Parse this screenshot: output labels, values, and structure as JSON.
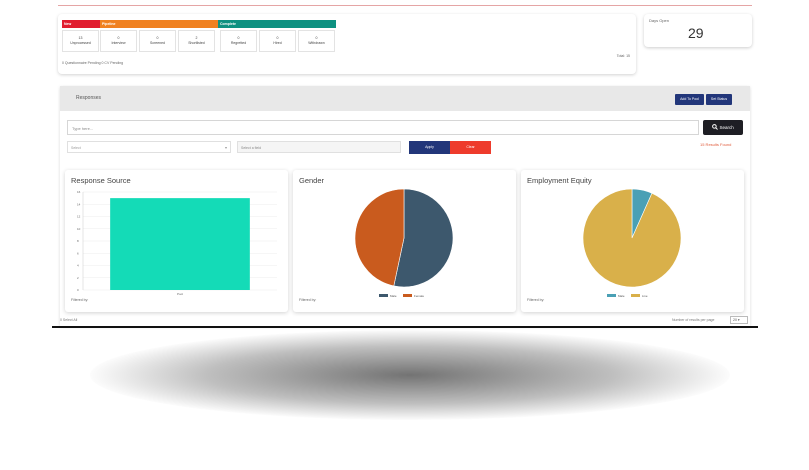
{
  "pipeline": {
    "stages": [
      {
        "label": "New",
        "color": "#e11d2f"
      },
      {
        "label": "Pipeline",
        "color": "#f08121"
      },
      {
        "label": "Complete",
        "color": "#0e9181"
      }
    ],
    "stats": [
      {
        "value": "13",
        "label": "Unprocessed"
      },
      {
        "value": "0",
        "label": "Interview"
      },
      {
        "value": "0",
        "label": "Screened"
      },
      {
        "value": "2",
        "label": "Shortlisted"
      },
      {
        "value": "0",
        "label": "Regretted"
      },
      {
        "value": "0",
        "label": "Hired"
      },
      {
        "value": "0",
        "label": "Withdrawn"
      }
    ],
    "footnote": "0 Questionnaire Pending  0 CV Pending",
    "total": "Total: 15"
  },
  "days_open": {
    "label": "Days Open",
    "value": "29"
  },
  "responses": {
    "title": "Responses",
    "add_to_pool": "Add To Pool",
    "set_status": "Set Status",
    "search_placeholder": "Type here...",
    "search_button": "Search",
    "results_found": "15 Results Found",
    "select_placeholder": "Select",
    "field_placeholder": "Select a field",
    "apply": "Apply",
    "clear": "Clear"
  },
  "charts": {
    "response_source": {
      "title": "Response Source",
      "filtered_by": "Filtered by:"
    },
    "gender": {
      "title": "Gender",
      "filtered_by": "Filtered by:"
    },
    "employment_equity": {
      "title": "Employment Equity",
      "filtered_by": "Filtered by:"
    }
  },
  "chart_data": [
    {
      "type": "bar",
      "title": "Response Source",
      "categories": [
        "Pool"
      ],
      "values": [
        15
      ],
      "ylim": [
        0,
        16
      ],
      "yticks": [
        "16",
        "14",
        "12",
        "10",
        "8",
        "6",
        "4",
        "2",
        "0"
      ],
      "colors": [
        "#14dbb7"
      ],
      "grid": true
    },
    {
      "type": "pie",
      "title": "Gender",
      "labels": [
        "Male",
        "Female"
      ],
      "values": [
        8,
        7
      ],
      "colors": [
        "#3d586d",
        "#c95b1e"
      ],
      "legend": "bottom"
    },
    {
      "type": "pie",
      "title": "Employment Equity",
      "labels": [
        "Male",
        "Live"
      ],
      "values": [
        1,
        14
      ],
      "colors": [
        "#4aa0b5",
        "#d9b04a"
      ],
      "legend": "bottom"
    }
  ],
  "footer": {
    "selected": "0 Select All",
    "per_page_label": "Number of results per page",
    "per_page_value": "20"
  }
}
